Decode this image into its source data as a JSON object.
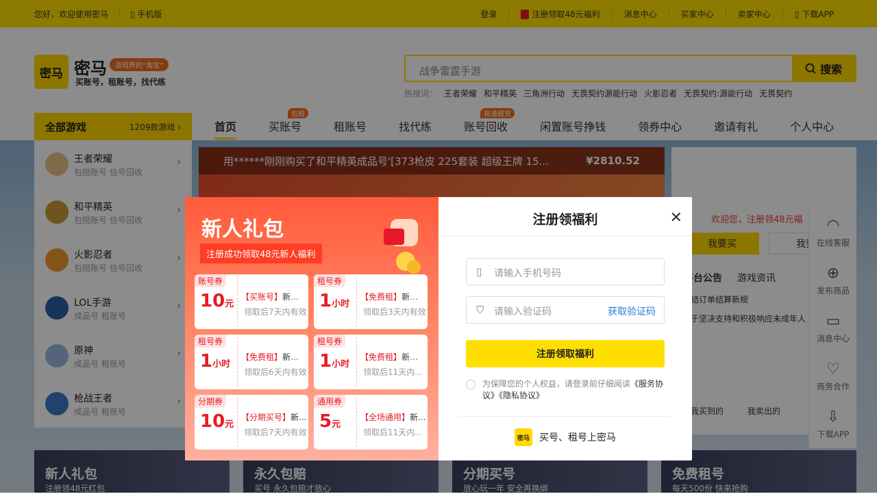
{
  "topbar": {
    "greeting": "您好，欢迎使用密马",
    "mobile": "手机版",
    "links": [
      "登录",
      "注册领取48元福利",
      "消息中心",
      "买家中心",
      "卖家中心",
      "下载APP"
    ]
  },
  "brand": {
    "logo_text": "密马",
    "name": "密马",
    "tag": "游戏界的“淘宝”",
    "slogan": "买账号，租账号，找代练"
  },
  "search": {
    "placeholder": "战争雷霆手游",
    "button": "搜索",
    "hot_label": "热搜词：",
    "hot_words": [
      "王者荣耀",
      "和平精英",
      "三角洲行动",
      "无畏契约源能行动",
      "火影忍者",
      "无畏契约:源能行动",
      "无畏契约"
    ]
  },
  "nav": {
    "all_games": "全部游戏",
    "count": "1209款游戏",
    "items": [
      {
        "label": "首页",
        "tip": ""
      },
      {
        "label": "买账号",
        "tip": "包赔"
      },
      {
        "label": "租账号",
        "tip": ""
      },
      {
        "label": "找代练",
        "tip": ""
      },
      {
        "label": "账号回收",
        "tip": "极速脱货"
      },
      {
        "label": "闲置账号挣钱",
        "tip": ""
      },
      {
        "label": "领券中心",
        "tip": ""
      },
      {
        "label": "邀请有礼",
        "tip": ""
      },
      {
        "label": "个人中心",
        "tip": ""
      }
    ]
  },
  "games": [
    {
      "name": "王者荣耀",
      "sub": "包赔账号 估号回收"
    },
    {
      "name": "和平精英",
      "sub": "包赔账号 估号回收"
    },
    {
      "name": "火影忍者",
      "sub": "包赔账号 估号回收"
    },
    {
      "name": "LOL手游",
      "sub": "成品号 租账号"
    },
    {
      "name": "原神",
      "sub": "成品号 租账号"
    },
    {
      "name": "枪战王者",
      "sub": "成品号 租账号"
    }
  ],
  "ticker": {
    "text": "用******刚刚购买了和平精英成品号'[373枪皮 225套装 超级王牌 15...",
    "price": "¥2810.52"
  },
  "rightpanel": {
    "welcome": "欢迎您，注册领48元福",
    "buy_btn": "我要买",
    "sell_btn": "我要",
    "tab1": "平台公告",
    "tab2": "游戏资讯",
    "line1": "结订单结算新规",
    "line2": "于坚决支持和积极响应未成年人",
    "bought": "我买到的",
    "sold": "我卖出的"
  },
  "rail": [
    "在线客服",
    "发布商品",
    "消息中心",
    "商务合作",
    "下载APP"
  ],
  "promos": [
    {
      "title": "新人礼包",
      "sub": "注册领48元红包"
    },
    {
      "title": "永久包赔",
      "sub": "买号 永久包赔才放心"
    },
    {
      "title": "分期买号",
      "sub": "放心玩一年 安全再换绑"
    },
    {
      "title": "免费租号",
      "sub": "每天500份 快来抢购"
    }
  ],
  "modal": {
    "left_title": "新人礼包",
    "left_sub": "注册成功领取48元新人福利",
    "coupons": [
      {
        "kind": "账号券",
        "amount": "10",
        "unit": "元",
        "title": "【买账号】",
        "name": "新人券",
        "validity": "领取后7天内有效"
      },
      {
        "kind": "租号券",
        "amount": "1",
        "unit": "小时",
        "title": "【免费租】",
        "name": "新人券",
        "validity": "领取后3天内有效"
      },
      {
        "kind": "租号券",
        "amount": "1",
        "unit": "小时",
        "title": "【免费租】",
        "name": "新人券",
        "validity": "领取后6天内有效"
      },
      {
        "kind": "租号券",
        "amount": "1",
        "unit": "小时",
        "title": "【免费租】",
        "name": "新人券",
        "validity": "领取后11天内..."
      },
      {
        "kind": "分期券",
        "amount": "10",
        "unit": "元",
        "title": "【分期买号】",
        "name": "新...",
        "validity": "领取后7天内有效"
      },
      {
        "kind": "通用券",
        "amount": "5",
        "unit": "元",
        "title": "【全场通用】",
        "name": "新...",
        "validity": "领取后11天内..."
      }
    ],
    "title": "注册领福利",
    "phone_placeholder": "请输入手机号码",
    "code_placeholder": "请输入验证码",
    "get_code": "获取验证码",
    "submit": "注册领取福利",
    "agree_text": "为保障您的个人权益，请登录前仔细阅读",
    "agree_link1": "《服务协议》",
    "agree_link2": "《隐私协议》",
    "footer": "买号、租号上密马",
    "footer_logo": "密马"
  },
  "colors": {
    "brand_yellow": "#ffe100",
    "accent_red": "#e51c23",
    "link_blue": "#2c7fd8"
  }
}
